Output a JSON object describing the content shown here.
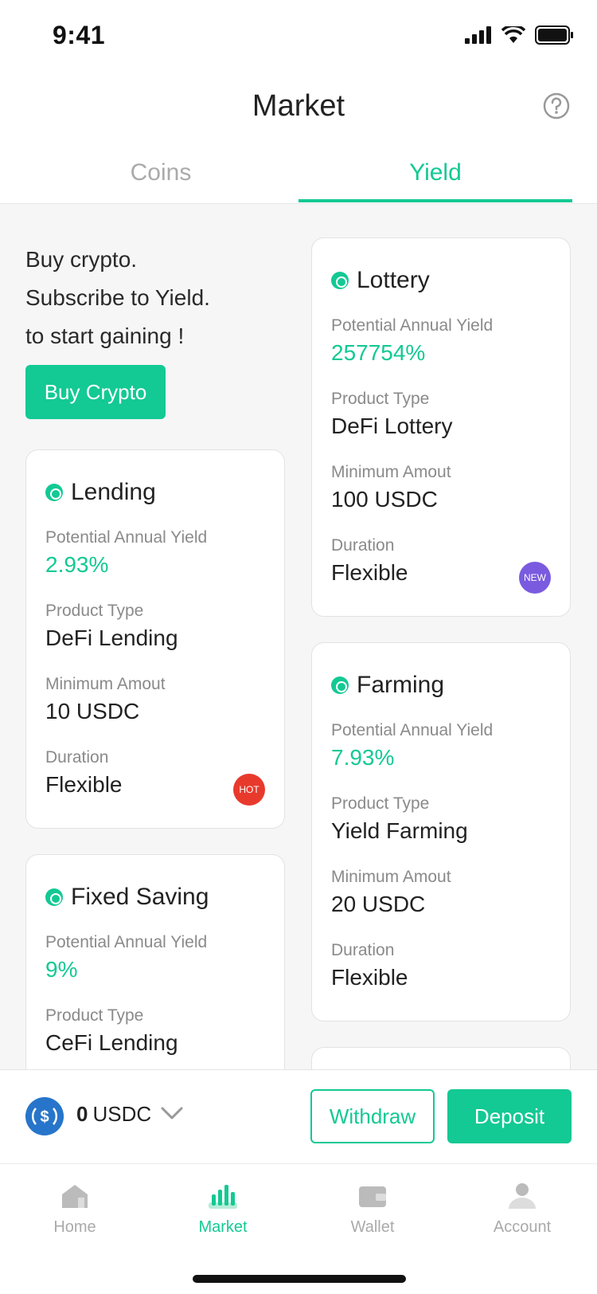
{
  "status_bar": {
    "time": "9:41"
  },
  "header": {
    "title": "Market"
  },
  "tabs": [
    {
      "label": "Coins"
    },
    {
      "label": "Yield"
    }
  ],
  "promo": {
    "line1": "Buy crypto.",
    "line2": "Subscribe to Yield.",
    "line3": "to start gaining !",
    "button": "Buy Crypto"
  },
  "cards": [
    {
      "name": "Lending",
      "yield_label": "Potential Annual Yield",
      "yield": "2.93%",
      "type_label": "Product Type",
      "type": "DeFi Lending",
      "min_label": "Minimum Amout",
      "min": "10 USDC",
      "duration_label": "Duration",
      "duration": "Flexible",
      "badge": "HOT"
    },
    {
      "name": "Lottery",
      "yield_label": "Potential Annual Yield",
      "yield": "257754%",
      "type_label": "Product Type",
      "type": "DeFi Lottery",
      "min_label": "Minimum Amout",
      "min": "100 USDC",
      "duration_label": "Duration",
      "duration": "Flexible",
      "badge": "NEW"
    },
    {
      "name": "Fixed Saving",
      "yield_label": "Potential Annual Yield",
      "yield": "9%",
      "type_label": "Product Type",
      "type": "CeFi Lending"
    },
    {
      "name": "Farming",
      "yield_label": "Potential Annual Yield",
      "yield": "7.93%",
      "type_label": "Product Type",
      "type": "Yield Farming",
      "min_label": "Minimum Amout",
      "min": "20 USDC",
      "duration_label": "Duration",
      "duration": "Flexible"
    }
  ],
  "balance": {
    "amount": "0",
    "currency": "USDC"
  },
  "actions": {
    "withdraw": "Withdraw",
    "deposit": "Deposit"
  },
  "tabbar": [
    {
      "label": "Home",
      "icon": "home-icon"
    },
    {
      "label": "Market",
      "icon": "market-icon"
    },
    {
      "label": "Wallet",
      "icon": "wallet-icon"
    },
    {
      "label": "Account",
      "icon": "account-icon"
    }
  ],
  "colors": {
    "accent": "#13c994",
    "hot": "#e83a2c",
    "new": "#7a5be0",
    "usdc": "#2775ca"
  }
}
